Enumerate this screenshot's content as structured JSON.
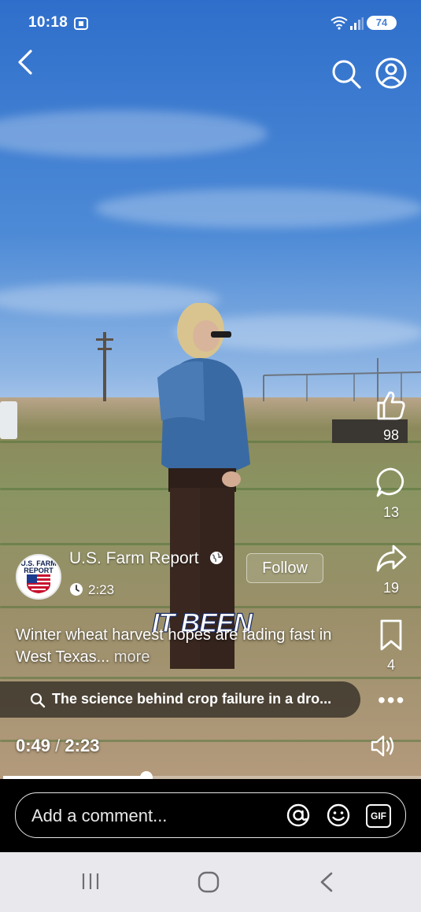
{
  "status_bar": {
    "time": "10:18",
    "battery": "74",
    "icons": [
      "screenshot-icon",
      "wifi-icon",
      "signal-icon",
      "battery-icon"
    ]
  },
  "top_bar": {
    "back_icon": "back-arrow-icon",
    "search_icon": "search-icon",
    "profile_icon": "profile-icon"
  },
  "rail": {
    "likes": "98",
    "comments": "13",
    "shares": "19",
    "saves": "4"
  },
  "author": {
    "name": "U.S. Farm Report",
    "avatar_text": "U.S. FARM REPORT",
    "follow_label": "Follow",
    "duration": "2:23",
    "visibility_icon": "globe-icon"
  },
  "video_overlay_caption": "IT BEEN",
  "description": {
    "text": "Winter wheat harvest hopes are fading fast in West Texas...",
    "more": "more"
  },
  "related_search": {
    "text": "The science behind crop failure in a dro..."
  },
  "playback": {
    "current": "0:49",
    "separator": "/",
    "total": "2:23",
    "progress": 0.343
  },
  "comment_bar": {
    "placeholder": "Add a comment...",
    "mention_icon": "at-icon",
    "emoji_icon": "emoji-icon",
    "gif_label": "GIF"
  },
  "colors": {
    "accent_white": "#ffffff",
    "comment_bg": "#000000",
    "nav_bg": "#e9e9ed"
  }
}
